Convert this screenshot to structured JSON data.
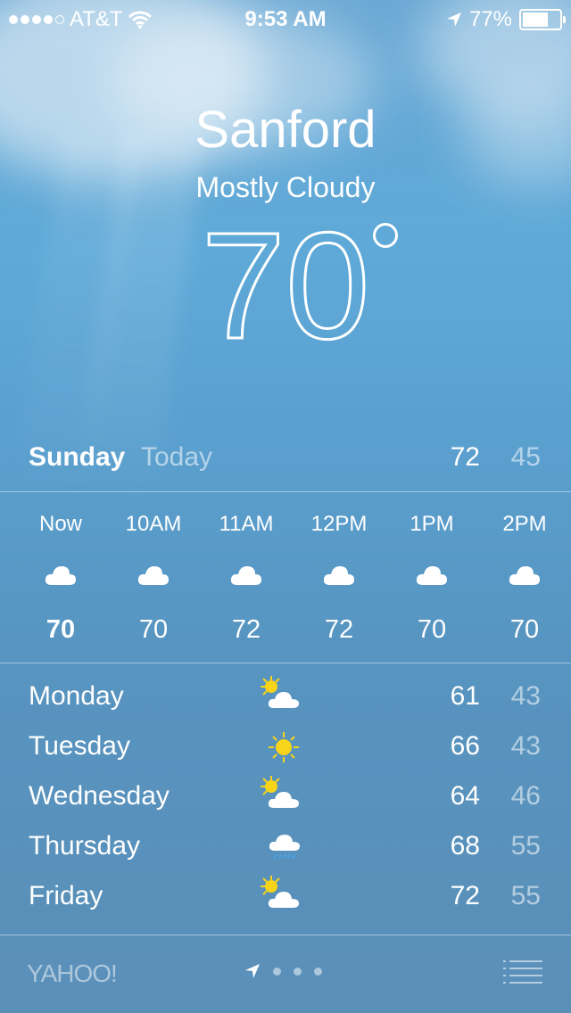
{
  "status_bar": {
    "carrier": "AT&T",
    "time": "9:53 AM",
    "battery": "77%",
    "battery_level": 0.77
  },
  "location": {
    "city": "Sanford",
    "condition": "Mostly Cloudy",
    "temperature": "70"
  },
  "today": {
    "day": "Sunday",
    "label": "Today",
    "high": "72",
    "low": "45"
  },
  "hourly": [
    {
      "time": "Now",
      "temp": "70",
      "icon": "cloud-icon"
    },
    {
      "time": "10AM",
      "temp": "70",
      "icon": "cloud-icon"
    },
    {
      "time": "11AM",
      "temp": "72",
      "icon": "cloud-icon"
    },
    {
      "time": "12PM",
      "temp": "72",
      "icon": "cloud-icon"
    },
    {
      "time": "1PM",
      "temp": "70",
      "icon": "cloud-icon"
    },
    {
      "time": "2PM",
      "temp": "70",
      "icon": "cloud-icon"
    }
  ],
  "daily": [
    {
      "day": "Monday",
      "high": "61",
      "low": "43",
      "icon": "partly-cloudy-icon"
    },
    {
      "day": "Tuesday",
      "high": "66",
      "low": "43",
      "icon": "sun-icon"
    },
    {
      "day": "Wednesday",
      "high": "64",
      "low": "46",
      "icon": "partly-cloudy-icon"
    },
    {
      "day": "Thursday",
      "high": "68",
      "low": "55",
      "icon": "rain-icon"
    },
    {
      "day": "Friday",
      "high": "72",
      "low": "55",
      "icon": "partly-cloudy-icon"
    }
  ],
  "footer": {
    "brand": "YAHOO!"
  },
  "colors": {
    "sun": "#f7d419",
    "rain": "#4aa3e8"
  }
}
